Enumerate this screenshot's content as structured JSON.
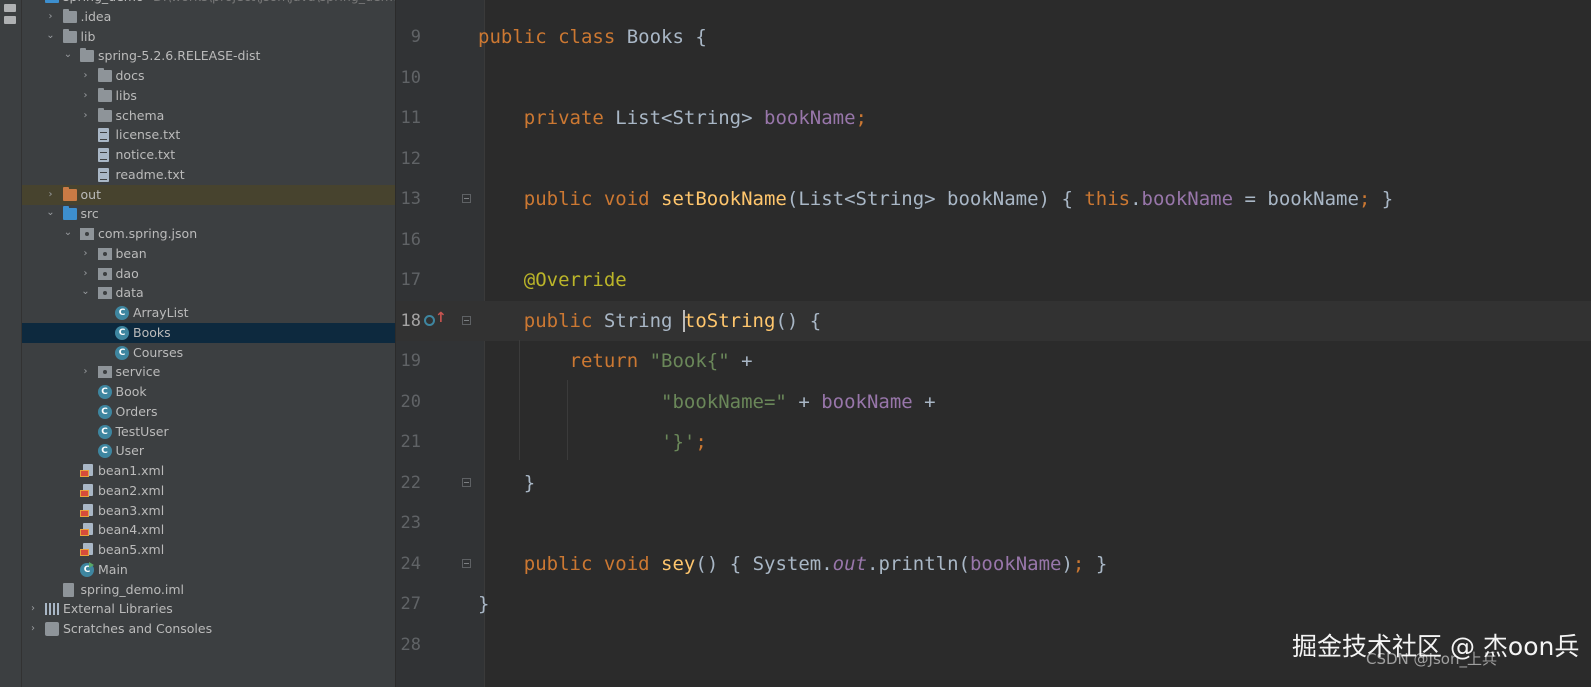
{
  "project_tree": {
    "rows": [
      {
        "label": "spring_demo",
        "path": "D:\\works\\project\\json\\java\\spring_demo",
        "indent": 1,
        "arrow": "open",
        "icon": "folder-blue",
        "icon_name": "project-folder-icon",
        "name": "tree-item-spring-demo"
      },
      {
        "label": ".idea",
        "indent": 2,
        "arrow": "closed",
        "icon": "folder-gray",
        "icon_name": "folder-icon",
        "name": "tree-item-idea"
      },
      {
        "label": "lib",
        "indent": 2,
        "arrow": "open",
        "icon": "folder-gray",
        "icon_name": "folder-icon",
        "name": "tree-item-lib"
      },
      {
        "label": "spring-5.2.6.RELEASE-dist",
        "indent": 3,
        "arrow": "open",
        "icon": "folder-gray",
        "icon_name": "folder-icon",
        "name": "tree-item-spring-dist"
      },
      {
        "label": "docs",
        "indent": 4,
        "arrow": "closed",
        "icon": "folder-gray",
        "icon_name": "folder-icon",
        "name": "tree-item-docs"
      },
      {
        "label": "libs",
        "indent": 4,
        "arrow": "closed",
        "icon": "folder-gray",
        "icon_name": "folder-icon",
        "name": "tree-item-libs"
      },
      {
        "label": "schema",
        "indent": 4,
        "arrow": "closed",
        "icon": "folder-gray",
        "icon_name": "folder-icon",
        "name": "tree-item-schema"
      },
      {
        "label": "license.txt",
        "indent": 4,
        "arrow": "none",
        "icon": "file-txt",
        "icon_name": "text-file-icon",
        "name": "tree-item-license"
      },
      {
        "label": "notice.txt",
        "indent": 4,
        "arrow": "none",
        "icon": "file-txt",
        "icon_name": "text-file-icon",
        "name": "tree-item-notice"
      },
      {
        "label": "readme.txt",
        "indent": 4,
        "arrow": "none",
        "icon": "file-txt",
        "icon_name": "text-file-icon",
        "name": "tree-item-readme"
      },
      {
        "label": "out",
        "indent": 2,
        "arrow": "closed",
        "icon": "folder-orange",
        "icon_name": "excluded-folder-icon",
        "name": "tree-item-out",
        "state": "highlight"
      },
      {
        "label": "src",
        "indent": 2,
        "arrow": "open",
        "icon": "folder-blue",
        "icon_name": "source-folder-icon",
        "name": "tree-item-src"
      },
      {
        "label": "com.spring.json",
        "indent": 3,
        "arrow": "open",
        "icon": "pkg",
        "icon_name": "package-icon",
        "name": "tree-item-com-spring-json"
      },
      {
        "label": "bean",
        "indent": 4,
        "arrow": "closed",
        "icon": "pkg",
        "icon_name": "package-icon",
        "name": "tree-item-bean"
      },
      {
        "label": "dao",
        "indent": 4,
        "arrow": "closed",
        "icon": "pkg",
        "icon_name": "package-icon",
        "name": "tree-item-dao"
      },
      {
        "label": "data",
        "indent": 4,
        "arrow": "open",
        "icon": "pkg",
        "icon_name": "package-icon",
        "name": "tree-item-data"
      },
      {
        "label": "ArrayList",
        "indent": 5,
        "arrow": "none",
        "icon": "cls",
        "icon_name": "java-class-icon",
        "name": "tree-item-arraylist"
      },
      {
        "label": "Books",
        "indent": 5,
        "arrow": "none",
        "icon": "cls",
        "icon_name": "java-class-icon",
        "name": "tree-item-books",
        "state": "selected"
      },
      {
        "label": "Courses",
        "indent": 5,
        "arrow": "none",
        "icon": "cls",
        "icon_name": "java-class-icon",
        "name": "tree-item-courses"
      },
      {
        "label": "service",
        "indent": 4,
        "arrow": "closed",
        "icon": "pkg",
        "icon_name": "package-icon",
        "name": "tree-item-service"
      },
      {
        "label": "Book",
        "indent": 4,
        "arrow": "none",
        "icon": "cls",
        "icon_name": "java-class-icon",
        "name": "tree-item-book"
      },
      {
        "label": "Orders",
        "indent": 4,
        "arrow": "none",
        "icon": "cls",
        "icon_name": "java-class-icon",
        "name": "tree-item-orders"
      },
      {
        "label": "TestUser",
        "indent": 4,
        "arrow": "none",
        "icon": "cls",
        "icon_name": "java-test-class-icon",
        "name": "tree-item-testuser"
      },
      {
        "label": "User",
        "indent": 4,
        "arrow": "none",
        "icon": "cls",
        "icon_name": "java-class-icon",
        "name": "tree-item-user"
      },
      {
        "label": "bean1.xml",
        "indent": 3,
        "arrow": "none",
        "icon": "file-xml",
        "icon_name": "spring-xml-file-icon",
        "name": "tree-item-bean1-xml"
      },
      {
        "label": "bean2.xml",
        "indent": 3,
        "arrow": "none",
        "icon": "file-xml",
        "icon_name": "spring-xml-file-icon",
        "name": "tree-item-bean2-xml"
      },
      {
        "label": "bean3.xml",
        "indent": 3,
        "arrow": "none",
        "icon": "file-xml",
        "icon_name": "spring-xml-file-icon",
        "name": "tree-item-bean3-xml"
      },
      {
        "label": "bean4.xml",
        "indent": 3,
        "arrow": "none",
        "icon": "file-xml",
        "icon_name": "spring-xml-file-icon",
        "name": "tree-item-bean4-xml"
      },
      {
        "label": "bean5.xml",
        "indent": 3,
        "arrow": "none",
        "icon": "file-xml",
        "icon_name": "spring-xml-file-icon",
        "name": "tree-item-bean5-xml"
      },
      {
        "label": "Main",
        "indent": 3,
        "arrow": "none",
        "icon": "cls-main",
        "icon_name": "java-main-class-icon",
        "name": "tree-item-main"
      },
      {
        "label": "spring_demo.iml",
        "indent": 2,
        "arrow": "none",
        "icon": "file-iml",
        "icon_name": "module-file-icon",
        "name": "tree-item-iml"
      },
      {
        "label": "External Libraries",
        "indent": 1,
        "arrow": "closed",
        "icon": "lib-icon",
        "icon_name": "library-icon",
        "name": "tree-item-external-libraries"
      },
      {
        "label": "Scratches and Consoles",
        "indent": 1,
        "arrow": "closed",
        "icon": "scratch-icon",
        "icon_name": "scratches-icon",
        "name": "tree-item-scratches"
      }
    ]
  },
  "editor": {
    "lines": [
      {
        "num": "9",
        "tokens": [
          [
            "kw",
            "public class "
          ],
          [
            "ty",
            "Books "
          ],
          [
            "ty",
            "{"
          ]
        ]
      },
      {
        "num": "10",
        "tokens": []
      },
      {
        "num": "11",
        "tokens": [
          [
            "ty",
            "    "
          ],
          [
            "kw",
            "private "
          ],
          [
            "ty",
            "List<String> "
          ],
          [
            "fld",
            "bookName"
          ],
          [
            "sc",
            ";"
          ]
        ]
      },
      {
        "num": "12",
        "tokens": []
      },
      {
        "num": "13",
        "fold": true,
        "tokens": [
          [
            "ty",
            "    "
          ],
          [
            "kw",
            "public void "
          ],
          [
            "fn",
            "setBookName"
          ],
          [
            "ty",
            "(List<String> bookName) "
          ],
          [
            "ty",
            "{ "
          ],
          [
            "kw",
            "this"
          ],
          [
            "ty",
            "."
          ],
          [
            "fld",
            "bookName"
          ],
          [
            "ty",
            " = bookName"
          ],
          [
            "sc",
            ";"
          ],
          [
            "ty",
            " }"
          ]
        ]
      },
      {
        "num": "16",
        "tokens": []
      },
      {
        "num": "17",
        "tokens": [
          [
            "ty",
            "    "
          ],
          [
            "an",
            "@Override"
          ]
        ]
      },
      {
        "num": "18",
        "current": true,
        "fold": true,
        "override": true,
        "tokens": [
          [
            "ty",
            "    "
          ],
          [
            "kw",
            "public "
          ],
          [
            "ty",
            "String "
          ],
          [
            "fn",
            "toString"
          ],
          [
            "ty",
            "() {"
          ]
        ]
      },
      {
        "num": "19",
        "tokens": [
          [
            "ty",
            "        "
          ],
          [
            "kw",
            "return "
          ],
          [
            "str",
            "\"Book{\""
          ],
          [
            "ty",
            " +"
          ]
        ]
      },
      {
        "num": "20",
        "tokens": [
          [
            "ty",
            "                "
          ],
          [
            "str",
            "\"bookName=\""
          ],
          [
            "ty",
            " + "
          ],
          [
            "fld",
            "bookName"
          ],
          [
            "ty",
            " +"
          ]
        ]
      },
      {
        "num": "21",
        "tokens": [
          [
            "ty",
            "                "
          ],
          [
            "str",
            "'}'"
          ],
          [
            "sc",
            ";"
          ]
        ]
      },
      {
        "num": "22",
        "fold": true,
        "tokens": [
          [
            "ty",
            "    }"
          ]
        ]
      },
      {
        "num": "23",
        "tokens": []
      },
      {
        "num": "24",
        "fold": true,
        "tokens": [
          [
            "ty",
            "    "
          ],
          [
            "kw",
            "public void "
          ],
          [
            "fn",
            "sey"
          ],
          [
            "ty",
            "() "
          ],
          [
            "ty",
            "{ "
          ],
          [
            "ty",
            "System."
          ],
          [
            "it",
            "out"
          ],
          [
            "ty",
            ".println("
          ],
          [
            "fld",
            "bookName"
          ],
          [
            "ty",
            ")"
          ],
          [
            "sc",
            ";"
          ],
          [
            "ty",
            " }"
          ]
        ]
      },
      {
        "num": "27",
        "tokens": [
          [
            "ty",
            "}"
          ]
        ]
      },
      {
        "num": "28",
        "tokens": []
      }
    ]
  },
  "watermark": {
    "primary": "掘金技术社区 @ 杰oon兵",
    "secondary": "CSDN @Json_上兵"
  },
  "colors": {
    "keyword": "#cc7832",
    "field": "#9876aa",
    "method": "#ffc66d",
    "annotation": "#bbb529",
    "string": "#6a8759",
    "selection": "#0d293e"
  }
}
